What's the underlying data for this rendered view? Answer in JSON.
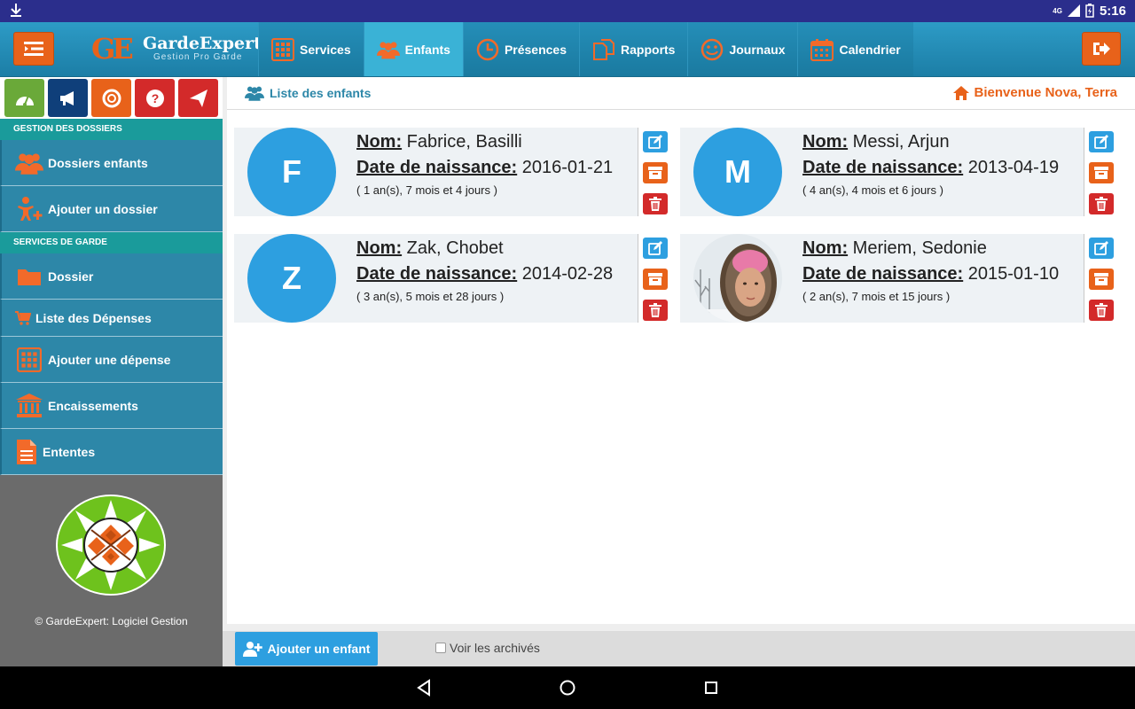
{
  "status_bar": {
    "network": "4G",
    "time": "5:16"
  },
  "app": {
    "logo_mark": "GE",
    "logo_name": "GardeExpert",
    "logo_tagline": "Gestion Pro Garde"
  },
  "top_nav": [
    {
      "label": "Services",
      "icon": "calculator-icon"
    },
    {
      "label": "Enfants",
      "icon": "users-icon",
      "active": true
    },
    {
      "label": "Présences",
      "icon": "clock-icon"
    },
    {
      "label": "Rapports",
      "icon": "copy-icon"
    },
    {
      "label": "Journaux",
      "icon": "smile-icon"
    },
    {
      "label": "Calendrier",
      "icon": "calendar-icon"
    }
  ],
  "sidebar": {
    "section_dossiers": "GESTION DES DOSSIERS",
    "section_services": "SERVICES DE GARDE",
    "items": [
      {
        "label": "Dossiers enfants"
      },
      {
        "label": "Ajouter un dossier"
      },
      {
        "label": "Dossier"
      },
      {
        "label": "Liste des Dépenses"
      },
      {
        "label": "Ajouter une dépense"
      },
      {
        "label": "Encaissements"
      },
      {
        "label": "Ententes"
      }
    ],
    "copyright": "© GardeExpert: Logiciel Gestion"
  },
  "breadcrumb": "Liste des enfants",
  "welcome": "Bienvenue Nova, Terra",
  "labels": {
    "nom": "Nom:",
    "dob": "Date de naissance:"
  },
  "children": [
    {
      "initial": "F",
      "name": "Fabrice, Basilli",
      "dob": "2016-01-21",
      "age": "( 1 an(s), 7 mois et 4 jours )",
      "photo": false
    },
    {
      "initial": "M",
      "name": "Messi, Arjun",
      "dob": "2013-04-19",
      "age": "( 4 an(s), 4 mois et 6 jours )",
      "photo": false
    },
    {
      "initial": "Z",
      "name": "Zak, Chobet",
      "dob": "2014-02-28",
      "age": "( 3 an(s), 5 mois et 28 jours )",
      "photo": false
    },
    {
      "initial": "",
      "name": "Meriem, Sedonie",
      "dob": "2015-01-10",
      "age": "( 2 an(s), 7 mois et 15 jours )",
      "photo": true
    }
  ],
  "footer": {
    "add_label": "Ajouter un enfant",
    "archives_label": "Voir les archivés",
    "archives_checked": false
  },
  "colors": {
    "primary": "#2d87a8",
    "accent": "#e8621a",
    "blue": "#2d9fe0",
    "danger": "#d32a2a",
    "statusbar": "#2b2e8c"
  }
}
